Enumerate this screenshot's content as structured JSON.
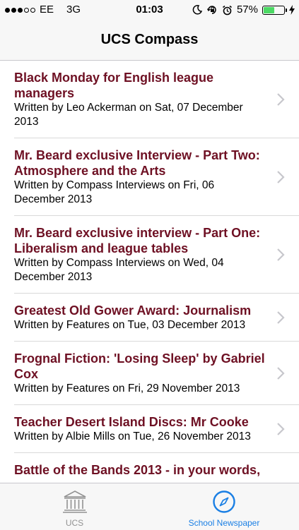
{
  "status_bar": {
    "carrier": "EE",
    "network": "3G",
    "time": "01:03",
    "battery_percent": "57%",
    "battery_level": 0.57,
    "battery_color": "#4cd964"
  },
  "nav": {
    "title": "UCS Compass"
  },
  "articles": [
    {
      "title": "Black Monday for English league managers",
      "byline": "Written by Leo Ackerman on Sat, 07 December 2013"
    },
    {
      "title": "Mr. Beard exclusive Interview - Part Two: Atmosphere and the Arts",
      "byline": "Written by Compass Interviews on Fri, 06 December 2013"
    },
    {
      "title": "Mr. Beard exclusive interview - Part One: Liberalism and league tables",
      "byline": "Written by Compass Interviews on Wed, 04 December 2013"
    },
    {
      "title": "Greatest Old Gower Award: Journalism",
      "byline": "Written by Features on Tue, 03 December 2013"
    },
    {
      "title": "Frognal Fiction: 'Losing Sleep' by Gabriel Cox",
      "byline": "Written by Features on Fri, 29 November 2013"
    },
    {
      "title": "Teacher Desert Island Discs: Mr Cooke",
      "byline": "Written by Albie Mills on Tue, 26 November 2013"
    },
    {
      "title": "Battle of the Bands 2013 - in your words,",
      "byline": ""
    }
  ],
  "tabs": [
    {
      "label": "UCS",
      "icon": "institution-icon",
      "active": false
    },
    {
      "label": "School Newspaper",
      "icon": "compass-icon",
      "active": true
    }
  ],
  "colors": {
    "title_color": "#6e1023",
    "active_tab": "#1a7fe4",
    "inactive_tab": "#929292"
  }
}
